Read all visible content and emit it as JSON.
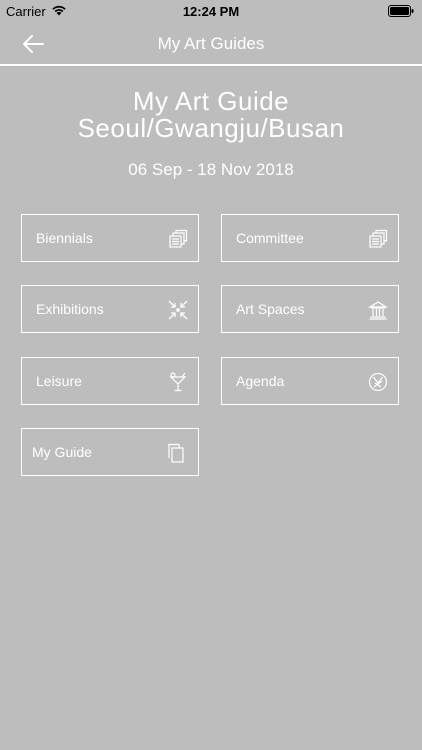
{
  "status_bar": {
    "carrier": "Carrier",
    "time": "12:24 PM"
  },
  "nav": {
    "title": "My Art Guides"
  },
  "hero": {
    "title": "My Art Guide",
    "subtitle": "Seoul/Gwangju/Busan",
    "dates": "06 Sep - 18 Nov 2018"
  },
  "tiles": [
    {
      "label": "Biennials",
      "icon": "stack-icon"
    },
    {
      "label": "Committee",
      "icon": "stack-icon"
    },
    {
      "label": "Exhibitions",
      "icon": "arrows-inward-icon"
    },
    {
      "label": "Art Spaces",
      "icon": "building-icon"
    },
    {
      "label": "Leisure",
      "icon": "cocktail-icon"
    },
    {
      "label": "Agenda",
      "icon": "agenda-icon"
    },
    {
      "label": "My Guide",
      "icon": "documents-icon"
    }
  ],
  "colors": {
    "background": "#bdbdbd",
    "foreground": "#ffffff"
  }
}
